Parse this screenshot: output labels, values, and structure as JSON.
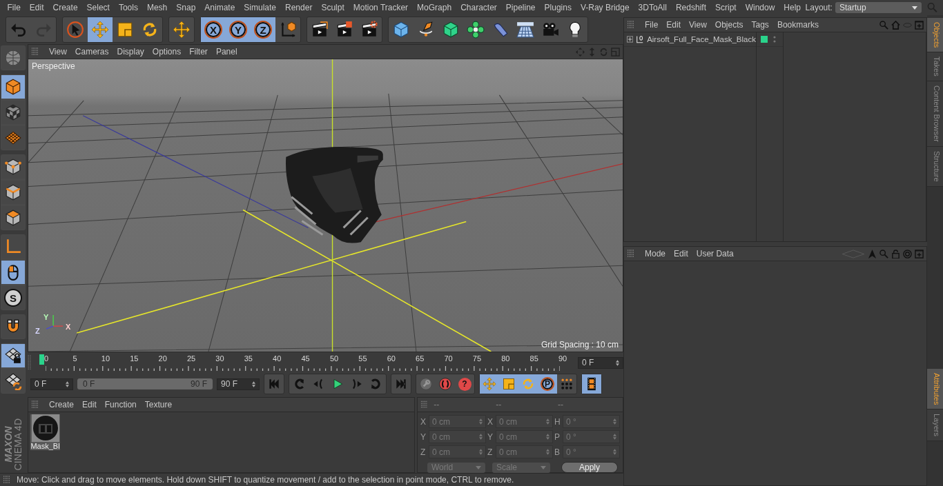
{
  "menu_bar": {
    "items": [
      "File",
      "Edit",
      "Create",
      "Select",
      "Tools",
      "Mesh",
      "Snap",
      "Animate",
      "Simulate",
      "Render",
      "Sculpt",
      "Motion Tracker",
      "MoGraph",
      "Character",
      "Pipeline",
      "Plugins",
      "V-Ray Bridge",
      "3DToAll",
      "Redshift",
      "Script",
      "Window",
      "Help"
    ],
    "layout_label": "Layout:",
    "layout_value": "Startup"
  },
  "toolbar": {
    "groups": [
      {
        "buttons": [
          {
            "kind": "undo",
            "selected": false,
            "disabled": false
          },
          {
            "kind": "redo",
            "selected": false,
            "disabled": true
          }
        ]
      },
      {
        "buttons": [
          {
            "kind": "select",
            "selected": false,
            "disabled": false
          },
          {
            "kind": "move",
            "selected": true,
            "disabled": false
          },
          {
            "kind": "scale",
            "selected": false,
            "disabled": false
          },
          {
            "kind": "rotate",
            "selected": false,
            "disabled": false
          }
        ]
      },
      {
        "buttons": [
          {
            "kind": "move",
            "selected": false,
            "disabled": false
          }
        ]
      },
      {
        "buttons": [
          {
            "kind": "letter",
            "label": "X",
            "selected": true,
            "disabled": false
          },
          {
            "kind": "letter",
            "label": "Y",
            "selected": true,
            "disabled": false
          },
          {
            "kind": "letter",
            "label": "Z",
            "selected": true,
            "disabled": false
          },
          {
            "kind": "axes",
            "selected": false,
            "disabled": false
          }
        ]
      },
      {
        "buttons": [
          {
            "kind": "clapper",
            "selected": false,
            "disabled": false
          },
          {
            "kind": "clapper2",
            "selected": false,
            "disabled": false
          },
          {
            "kind": "clapper3",
            "selected": false,
            "disabled": false
          }
        ]
      },
      {
        "buttons": [
          {
            "kind": "cube",
            "selected": false,
            "disabled": false
          },
          {
            "kind": "pen",
            "selected": false,
            "disabled": false
          },
          {
            "kind": "greencube",
            "selected": false,
            "disabled": false
          },
          {
            "kind": "flower",
            "selected": false,
            "disabled": false
          },
          {
            "kind": "bend",
            "selected": false,
            "disabled": false
          },
          {
            "kind": "floor",
            "selected": false,
            "disabled": false
          },
          {
            "kind": "camera",
            "selected": false,
            "disabled": false
          },
          {
            "kind": "bulb",
            "selected": false,
            "disabled": false
          }
        ]
      }
    ]
  },
  "left_tools": {
    "groups": [
      {
        "buttons": [
          {
            "kind": "globe",
            "selected": false
          }
        ]
      },
      {
        "buttons": [
          {
            "kind": "ocube",
            "selected": true
          },
          {
            "kind": "checker",
            "selected": false
          },
          {
            "kind": "ogrid",
            "selected": false
          }
        ]
      },
      {
        "buttons": [
          {
            "kind": "points",
            "selected": false
          },
          {
            "kind": "edges",
            "selected": false
          },
          {
            "kind": "polys",
            "selected": false
          }
        ]
      },
      {
        "buttons": [
          {
            "kind": "axis",
            "selected": false
          },
          {
            "kind": "mouse",
            "selected": true
          },
          {
            "kind": "letter",
            "label": "S",
            "selected": false
          }
        ]
      },
      {
        "buttons": [
          {
            "kind": "magnet",
            "selected": false
          }
        ]
      },
      {
        "buttons": [
          {
            "kind": "gridlock",
            "selected": true
          },
          {
            "kind": "gridsync",
            "selected": false
          }
        ]
      }
    ],
    "logo_brand": "MAXON",
    "logo_product": "CINEMA 4D"
  },
  "viewport": {
    "menu": [
      "View",
      "Cameras",
      "Display",
      "Options",
      "Filter",
      "Panel"
    ],
    "camera_label": "Perspective",
    "grid_spacing": "Grid Spacing : 10 cm",
    "axis_labels": [
      "Y",
      "Z",
      "X"
    ]
  },
  "timeline": {
    "labels": [
      "0",
      "5",
      "10",
      "15",
      "20",
      "25",
      "30",
      "35",
      "40",
      "45",
      "50",
      "55",
      "60",
      "65",
      "70",
      "75",
      "80",
      "85",
      "90"
    ],
    "playhead": {
      "level": 0
    },
    "frame_field": "0 F"
  },
  "transport": {
    "start_field": "0 F",
    "range": {
      "start": "0 F",
      "end": "90 F",
      "level": 1
    },
    "end_field": "90 F",
    "groups": [
      {
        "buttons": [
          {
            "kind": "first",
            "selected": false
          }
        ]
      },
      {
        "buttons": [
          {
            "kind": "prevkey",
            "selected": false
          },
          {
            "kind": "prev",
            "selected": false
          },
          {
            "kind": "play",
            "selected": false
          },
          {
            "kind": "next",
            "selected": false
          },
          {
            "kind": "nextkey",
            "selected": false
          }
        ]
      },
      {
        "buttons": [
          {
            "kind": "last",
            "selected": false
          }
        ]
      },
      {
        "buttons": [
          {
            "kind": "record",
            "selected": false
          },
          {
            "kind": "autokey",
            "selected": false
          },
          {
            "kind": "redletter",
            "label": "?",
            "selected": false
          }
        ]
      },
      {
        "buttons": [
          {
            "kind": "move",
            "selected": true
          },
          {
            "kind": "scale",
            "selected": true
          },
          {
            "kind": "rotate",
            "selected": true
          },
          {
            "kind": "letter",
            "label": "P",
            "selected": true
          },
          {
            "kind": "dots",
            "selected": false
          }
        ]
      },
      {
        "buttons": [
          {
            "kind": "film",
            "selected": true
          }
        ]
      }
    ]
  },
  "materials": {
    "menu": [
      "Create",
      "Edit",
      "Function",
      "Texture"
    ],
    "items": [
      {
        "name": "Mask_Bl"
      }
    ]
  },
  "coordinates": {
    "headers": [
      "--",
      "--",
      "--"
    ],
    "columns": [
      {
        "rows": [
          {
            "label": "X",
            "value": "0 cm"
          },
          {
            "label": "Y",
            "value": "0 cm"
          },
          {
            "label": "Z",
            "value": "0 cm"
          }
        ]
      },
      {
        "rows": [
          {
            "label": "X",
            "value": "0 cm"
          },
          {
            "label": "Y",
            "value": "0 cm"
          },
          {
            "label": "Z",
            "value": "0 cm"
          }
        ]
      },
      {
        "rows": [
          {
            "label": "H",
            "value": "0 °"
          },
          {
            "label": "P",
            "value": "0 °"
          },
          {
            "label": "B",
            "value": "0 °"
          }
        ]
      }
    ],
    "dropdowns": [
      "World",
      "Scale"
    ],
    "apply": "Apply"
  },
  "status_bar": "Move: Click and drag to move elements. Hold down SHIFT to quantize movement / add to the selection in point mode, CTRL to remove.",
  "object_manager": {
    "menu": [
      "File",
      "Edit",
      "View",
      "Objects",
      "Tags",
      "Bookmarks"
    ],
    "objects": [
      {
        "name": "Airsoft_Full_Face_Mask_Black",
        "expanded": false,
        "color": "#2ad38b"
      }
    ]
  },
  "attributes": {
    "menu": [
      "Mode",
      "Edit",
      "User Data"
    ]
  },
  "side_tabs": {
    "top": [
      {
        "label": "Objects",
        "selected": true
      },
      {
        "label": "Takes",
        "selected": false
      },
      {
        "label": "Content Browser",
        "selected": false
      },
      {
        "label": "Structure",
        "selected": false
      }
    ],
    "bottom": [
      {
        "label": "Attributes",
        "selected": true
      },
      {
        "label": "Layers",
        "selected": false
      }
    ]
  }
}
